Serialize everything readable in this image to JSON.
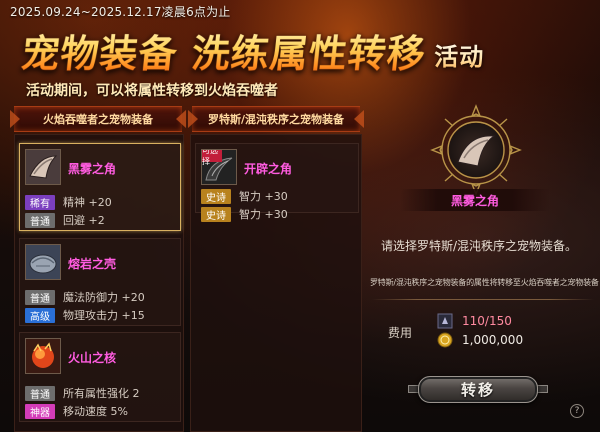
{
  "event": {
    "date_range": "2025.09.24~2025.12.17凌晨6点为止",
    "title": "宠物装备 洗练属性转移",
    "title_tag": "活动",
    "subtitle": "活动期间，可以将属性转移到火焰吞噬者"
  },
  "columns": {
    "left_header": "火焰吞噬者之宠物装备",
    "right_header": "罗特斯/混沌秩序之宠物装备"
  },
  "colors": {
    "rare": "#7b3fbf",
    "normal": "#6d6d6d",
    "advanced": "#2a6fd6",
    "epic": "#b8821e",
    "divine": "#d43cb8",
    "item_name": "#ff5ce0",
    "selected_border": "#d9b160"
  },
  "left_items": [
    {
      "name": "黑雾之角",
      "icon": "dark-horn-icon",
      "stats": [
        {
          "grade": "稀有",
          "grade_key": "rare",
          "text": "精神 +20"
        },
        {
          "grade": "普通",
          "grade_key": "normal",
          "text": "回避 +2"
        }
      ]
    },
    {
      "name": "熔岩之壳",
      "icon": "lava-shell-icon",
      "stats": [
        {
          "grade": "普通",
          "grade_key": "normal",
          "text": "魔法防御力 +20"
        },
        {
          "grade": "高级",
          "grade_key": "advanced",
          "text": "物理攻击力 +15"
        }
      ]
    },
    {
      "name": "火山之核",
      "icon": "volcano-core-icon",
      "stats": [
        {
          "grade": "普通",
          "grade_key": "normal",
          "text": "所有属性强化 2"
        },
        {
          "grade": "神器",
          "grade_key": "divine",
          "text": "移动速度 5%"
        }
      ]
    }
  ],
  "right_items": [
    {
      "name": "开辟之角",
      "icon": "pioneer-horn-icon",
      "ribbon": "可选择",
      "stats": [
        {
          "grade": "史诗",
          "grade_key": "epic",
          "text": "智力 +30"
        },
        {
          "grade": "史诗",
          "grade_key": "epic",
          "text": "智力 +30"
        }
      ]
    }
  ],
  "detail": {
    "selected_name": "黑雾之角",
    "instruction": "请选择罗特斯/混沌秩序之宠物装备。",
    "note": "罗特斯/混沌秩序之宠物装备的属性将转移至火焰吞噬者之宠物装备"
  },
  "fee": {
    "label": "费用",
    "material_amount": "110/150",
    "gold_amount": "1,000,000",
    "material_icon": "material-stone-icon",
    "gold_icon": "gold-coin-icon"
  },
  "actions": {
    "transfer_label": "转移",
    "help_label": "?"
  }
}
